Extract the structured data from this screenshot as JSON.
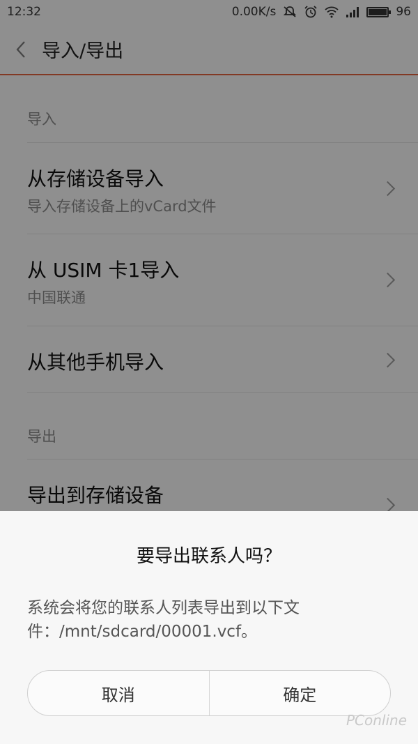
{
  "status_bar": {
    "time": "12:32",
    "net_speed": "0.00K/s",
    "battery_level": "96",
    "icons": [
      "mute-icon",
      "alarm-icon",
      "wifi-icon",
      "signal-icon",
      "battery-icon"
    ]
  },
  "header": {
    "title": "导入/导出",
    "accent_color": "#e0623e"
  },
  "import_section": {
    "label": "导入",
    "items": [
      {
        "title": "从存储设备导入",
        "subtitle": "导入存储设备上的vCard文件"
      },
      {
        "title": "从 USIM 卡1导入",
        "subtitle": "中国联通"
      },
      {
        "title": "从其他手机导入"
      }
    ]
  },
  "export_section": {
    "label": "导出",
    "items": [
      {
        "title": "导出到存储设备"
      }
    ]
  },
  "dialog": {
    "title": "要导出联系人吗？",
    "message": "系统会将您的联系人列表导出到以下文件：/mnt/sdcard/00001.vcf。",
    "cancel_label": "取消",
    "confirm_label": "确定"
  },
  "watermark": "PConline"
}
